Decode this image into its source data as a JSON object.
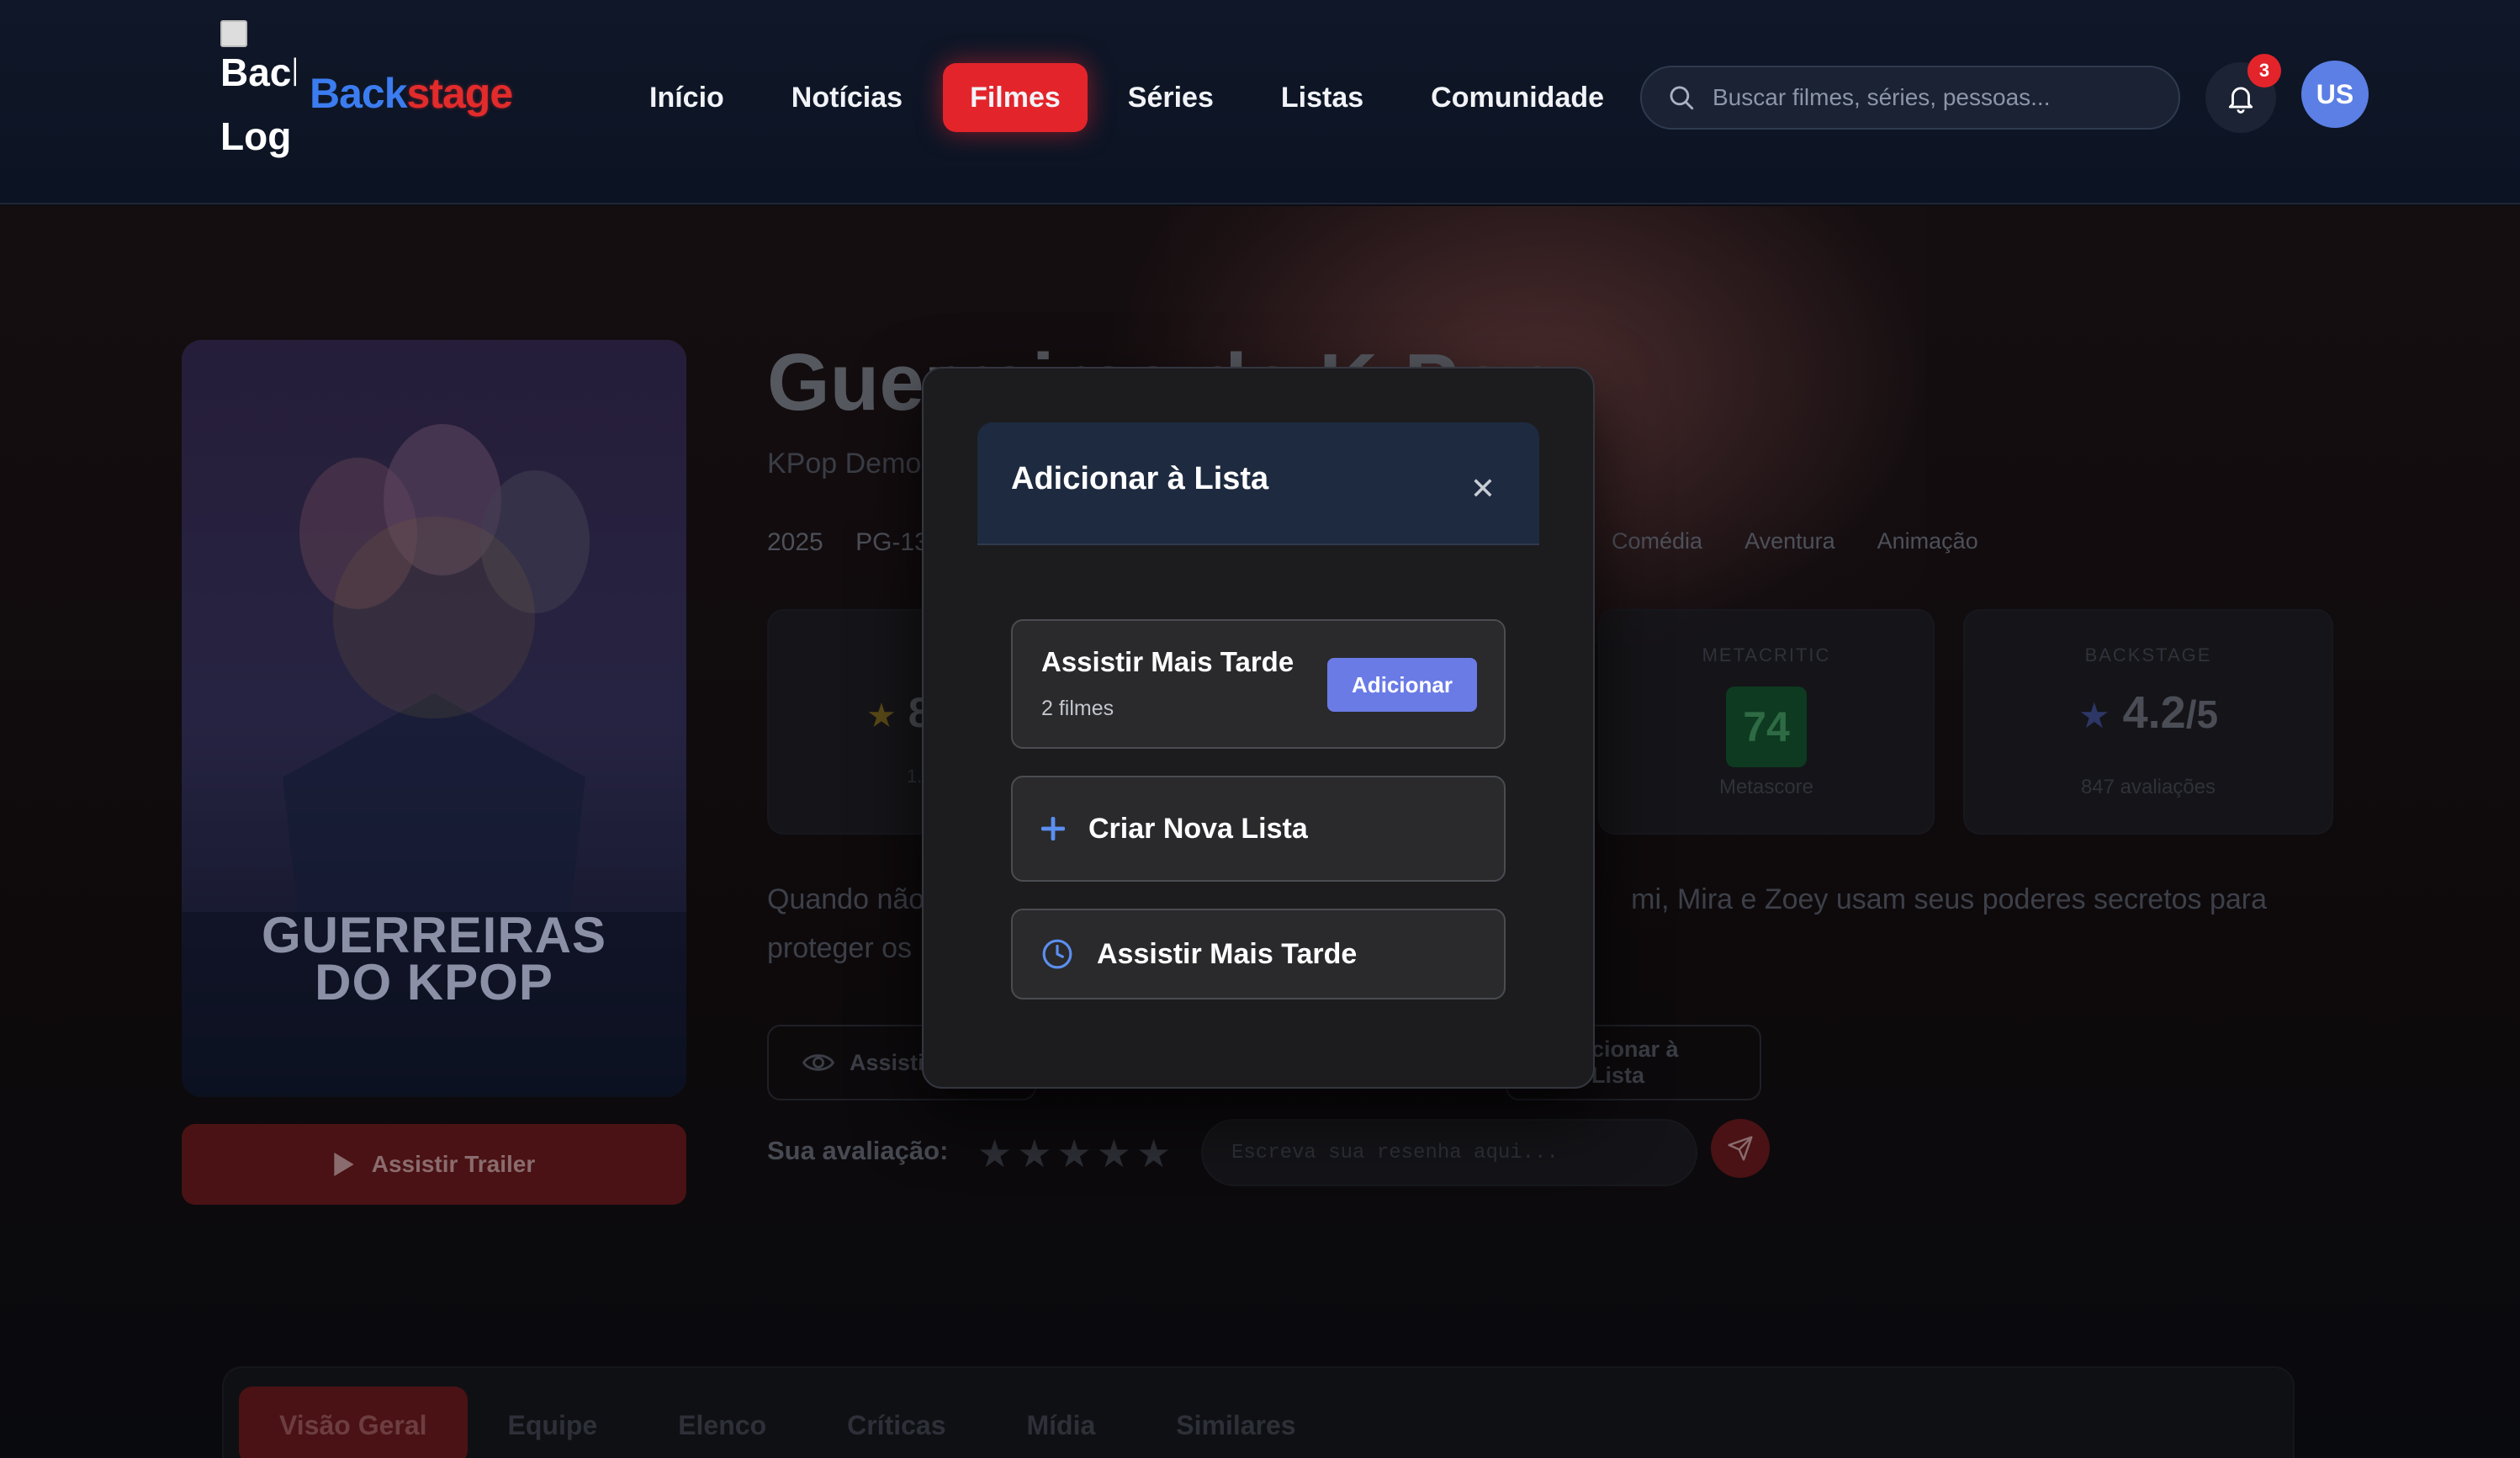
{
  "nav": {
    "logo_alt": "Back Log",
    "brand_part1": "Back",
    "brand_part2": "stage",
    "links": [
      "Início",
      "Notícias",
      "Filmes",
      "Séries",
      "Listas",
      "Comunidade"
    ],
    "active_link": "Filmes",
    "search_placeholder": "Buscar filmes, séries, pessoas...",
    "notification_count": "3",
    "avatar_initials": "US"
  },
  "movie": {
    "title": "Guerreiras do K-Pop",
    "original_title": "KPop Demon Hunters",
    "year": "2025",
    "rating": "PG-13",
    "genres": [
      "Comédia",
      "Aventura",
      "Animação"
    ],
    "poster_title_line1": "GUERREIRAS",
    "poster_title_line2": "DO KPOP",
    "trailer_label": "Assistir Trailer",
    "imdb_score": "8",
    "imdb_count": "1.",
    "metacritic_label": "METACRITIC",
    "metacritic_score": "74",
    "metacritic_sub": "Metascore",
    "backstage_label": "BACKSTAGE",
    "backstage_score": "4.2",
    "backstage_max": "/5",
    "backstage_count": "847 avaliações",
    "synopsis_start": "Quando não",
    "synopsis_end": "mi, Mira e Zoey usam seus poderes secretos para",
    "synopsis_line2": "proteger os",
    "watched_label": "Assisti",
    "add_list_label": "cionar à Lista",
    "your_rating_label": "Sua avaliação:",
    "review_placeholder": "Escreva sua resenha aqui..."
  },
  "tabs": [
    "Visão Geral",
    "Equipe",
    "Elenco",
    "Críticas",
    "Mídia",
    "Similares"
  ],
  "active_tab": "Visão Geral",
  "modal": {
    "title": "Adicionar à Lista",
    "lists": [
      {
        "name": "Assistir Mais Tarde",
        "count": "2 filmes",
        "action": "Adicionar"
      }
    ],
    "create_label": "Criar Nova Lista",
    "watch_later_label": "Assistir Mais Tarde"
  },
  "colors": {
    "accent_red": "#e3242b",
    "brand_blue": "#3b7cf0",
    "add_button": "#6a7be6",
    "modal_header": "#1e2a3f"
  }
}
